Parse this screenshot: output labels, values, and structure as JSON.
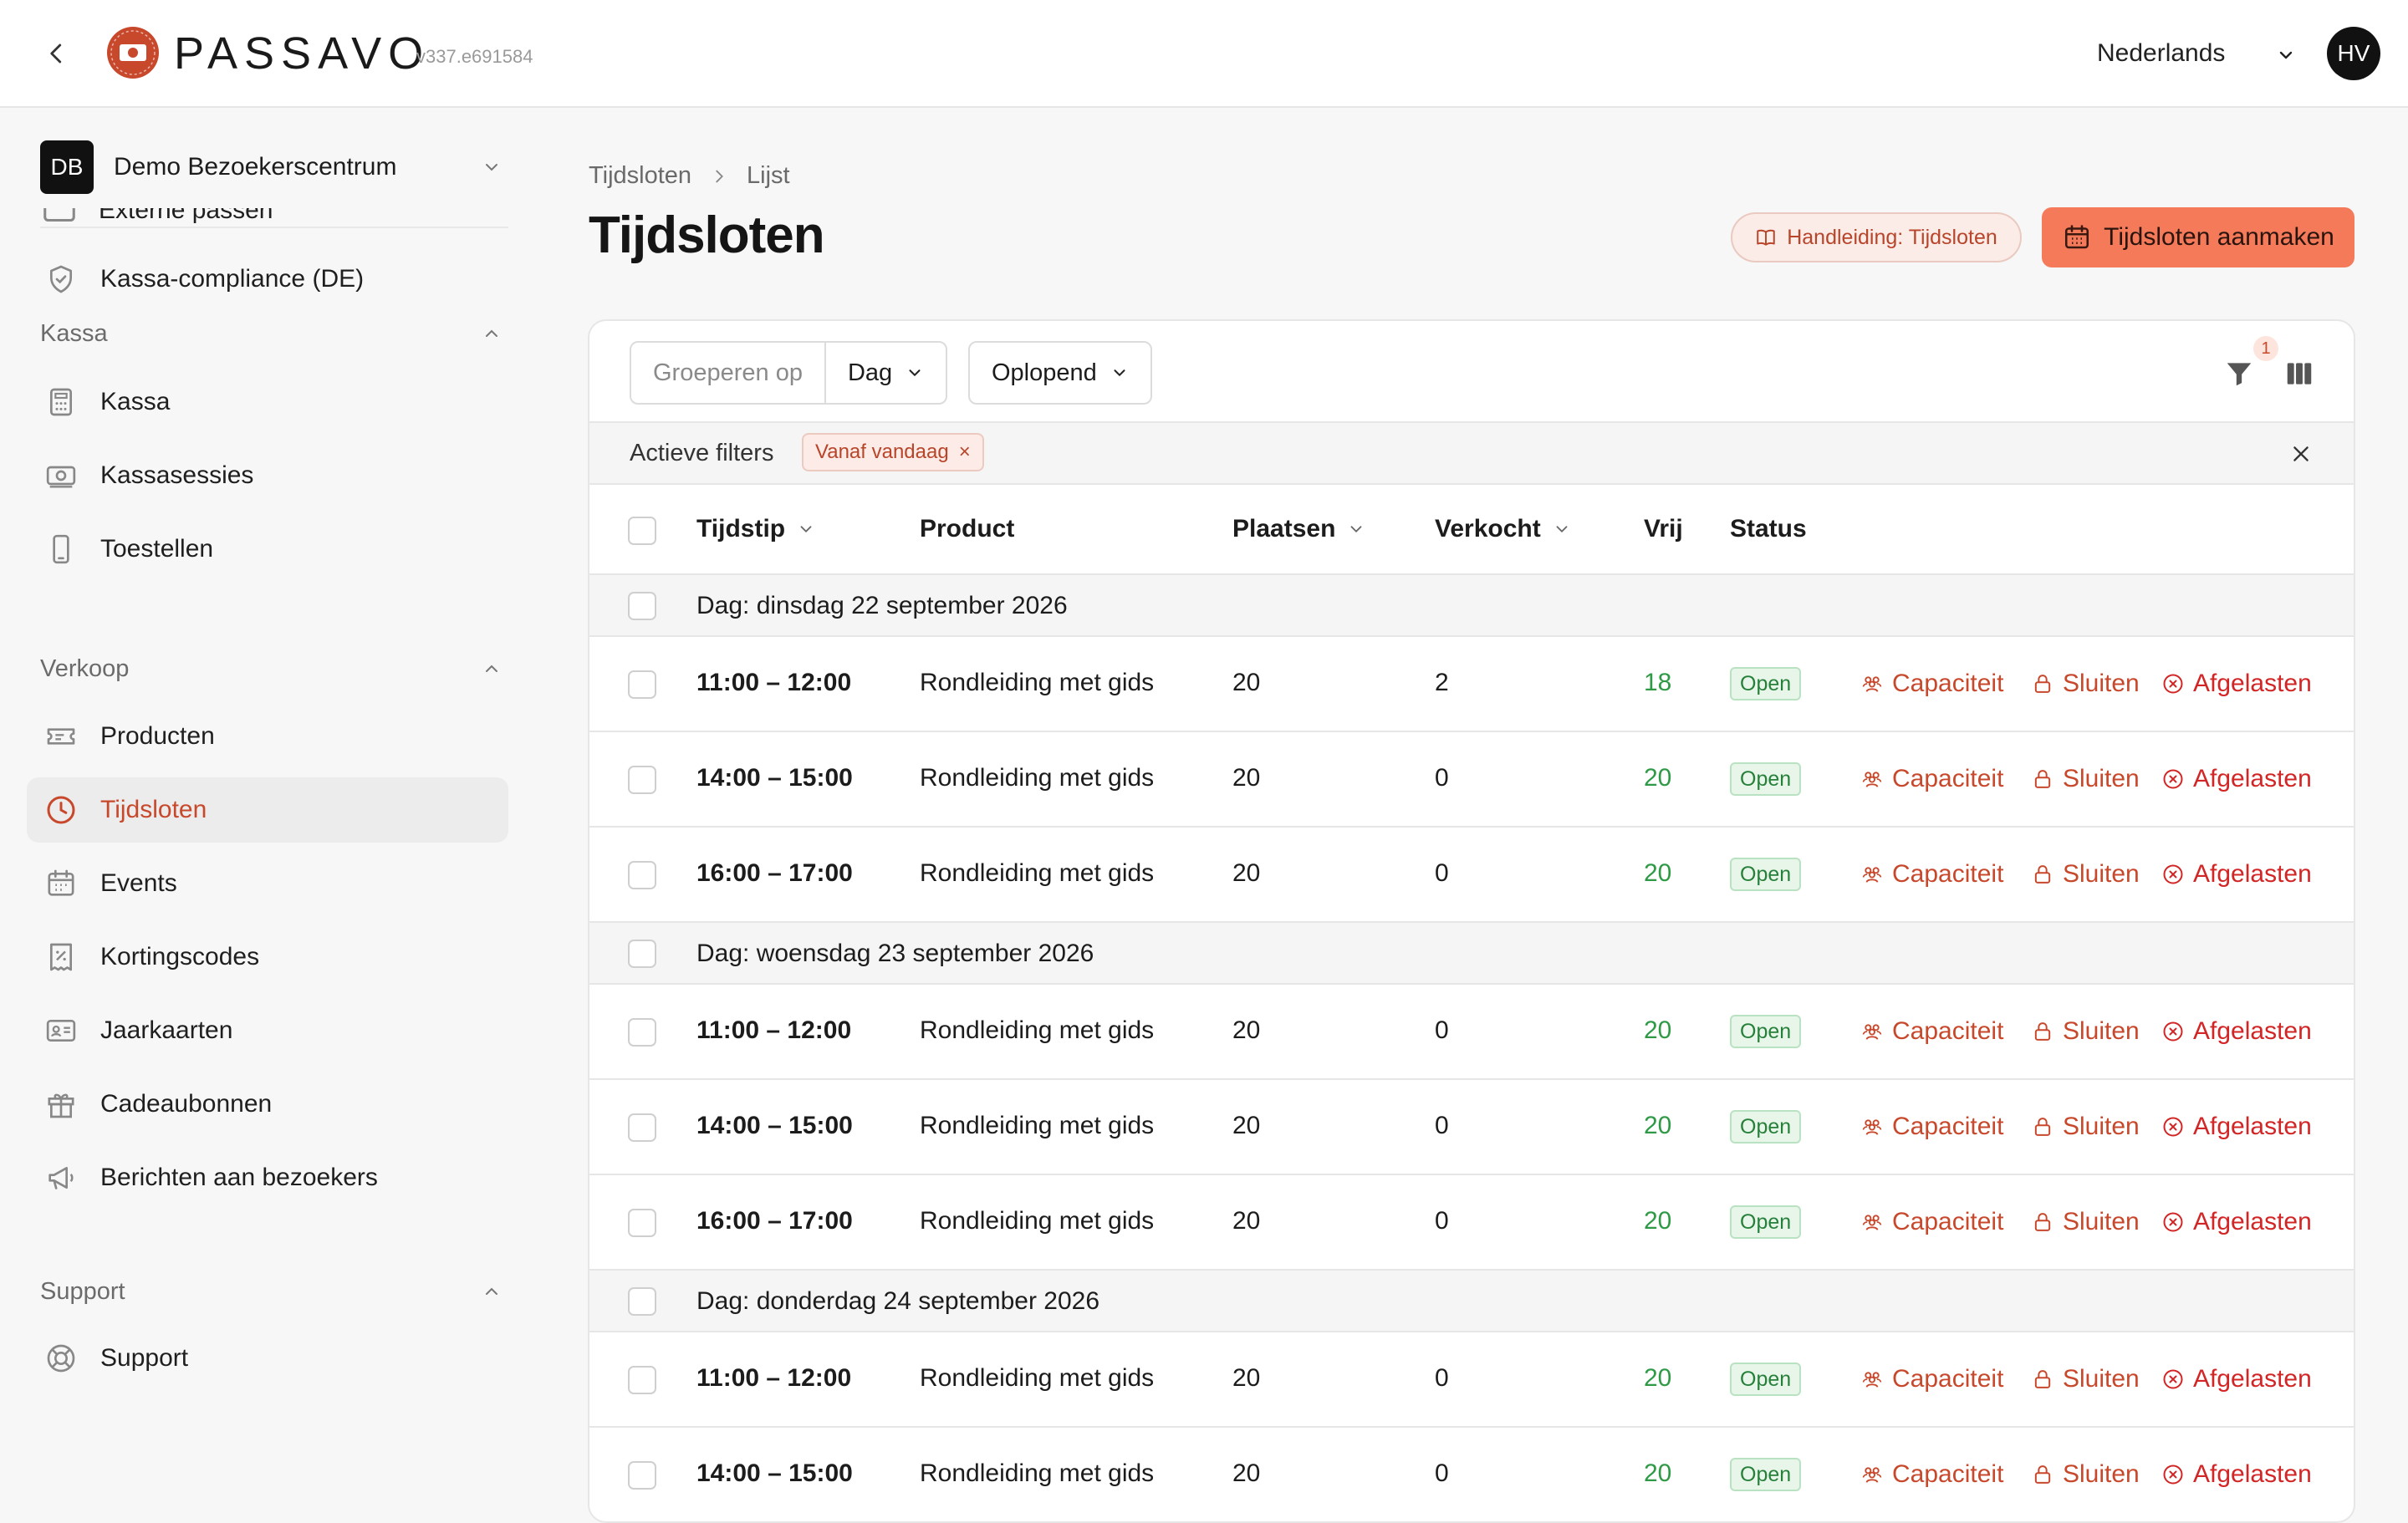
{
  "header": {
    "brand": "PASSAVO",
    "version": "v337.e691584",
    "language": "Nederlands",
    "avatar_initials": "HV",
    "accent": "#c8482c"
  },
  "sidebar": {
    "org_initials": "DB",
    "org_name": "Demo Bezoekerscentrum",
    "cut_item_label": "Externe passen",
    "top_items": [
      {
        "label": "Kassa-compliance (DE)",
        "icon": "shield-check-icon"
      }
    ],
    "sections": [
      {
        "title": "Kassa",
        "items": [
          {
            "label": "Kassa",
            "icon": "calculator-icon"
          },
          {
            "label": "Kassasessies",
            "icon": "cash-icon"
          },
          {
            "label": "Toestellen",
            "icon": "phone-icon"
          }
        ]
      },
      {
        "title": "Verkoop",
        "items": [
          {
            "label": "Producten",
            "icon": "ticket-icon"
          },
          {
            "label": "Tijdsloten",
            "icon": "clock-icon",
            "active": true
          },
          {
            "label": "Events",
            "icon": "calendar-icon"
          },
          {
            "label": "Kortingscodes",
            "icon": "discount-icon"
          },
          {
            "label": "Jaarkaarten",
            "icon": "id-card-icon"
          },
          {
            "label": "Cadeaubonnen",
            "icon": "gift-icon"
          },
          {
            "label": "Berichten aan bezoekers",
            "icon": "megaphone-icon"
          }
        ]
      },
      {
        "title": "Support",
        "items": [
          {
            "label": "Support",
            "icon": "lifebuoy-icon"
          }
        ]
      }
    ]
  },
  "main": {
    "breadcrumb": [
      "Tijdsloten",
      "Lijst"
    ],
    "title": "Tijdsloten",
    "manual_button": "Handleiding: Tijdsloten",
    "create_button": "Tijdsloten aanmaken",
    "toolbar": {
      "group_label": "Groeperen op",
      "group_value": "Dag",
      "order_value": "Oplopend",
      "filter_count": "1"
    },
    "filters": {
      "label": "Actieve filters",
      "chips": [
        "Vanaf vandaag"
      ]
    },
    "columns": {
      "time": "Tijdstip",
      "product": "Product",
      "seats": "Plaatsen",
      "sold": "Verkocht",
      "free": "Vrij",
      "status": "Status"
    },
    "actions": {
      "capacity": "Capaciteit",
      "close": "Sluiten",
      "cancel": "Afgelasten"
    },
    "groups": [
      {
        "label": "Dag: dinsdag 22 september 2026",
        "rows": [
          {
            "time": "11:00 – 12:00",
            "product": "Rondleiding met gids",
            "seats": "20",
            "sold": "2",
            "free": "18",
            "status": "Open"
          },
          {
            "time": "14:00 – 15:00",
            "product": "Rondleiding met gids",
            "seats": "20",
            "sold": "0",
            "free": "20",
            "status": "Open"
          },
          {
            "time": "16:00 – 17:00",
            "product": "Rondleiding met gids",
            "seats": "20",
            "sold": "0",
            "free": "20",
            "status": "Open"
          }
        ]
      },
      {
        "label": "Dag: woensdag 23 september 2026",
        "rows": [
          {
            "time": "11:00 – 12:00",
            "product": "Rondleiding met gids",
            "seats": "20",
            "sold": "0",
            "free": "20",
            "status": "Open"
          },
          {
            "time": "14:00 – 15:00",
            "product": "Rondleiding met gids",
            "seats": "20",
            "sold": "0",
            "free": "20",
            "status": "Open"
          },
          {
            "time": "16:00 – 17:00",
            "product": "Rondleiding met gids",
            "seats": "20",
            "sold": "0",
            "free": "20",
            "status": "Open"
          }
        ]
      },
      {
        "label": "Dag: donderdag 24 september 2026",
        "rows": [
          {
            "time": "11:00 – 12:00",
            "product": "Rondleiding met gids",
            "seats": "20",
            "sold": "0",
            "free": "20",
            "status": "Open"
          },
          {
            "time": "14:00 – 15:00",
            "product": "Rondleiding met gids",
            "seats": "20",
            "sold": "0",
            "free": "20",
            "status": "Open"
          }
        ]
      }
    ]
  }
}
